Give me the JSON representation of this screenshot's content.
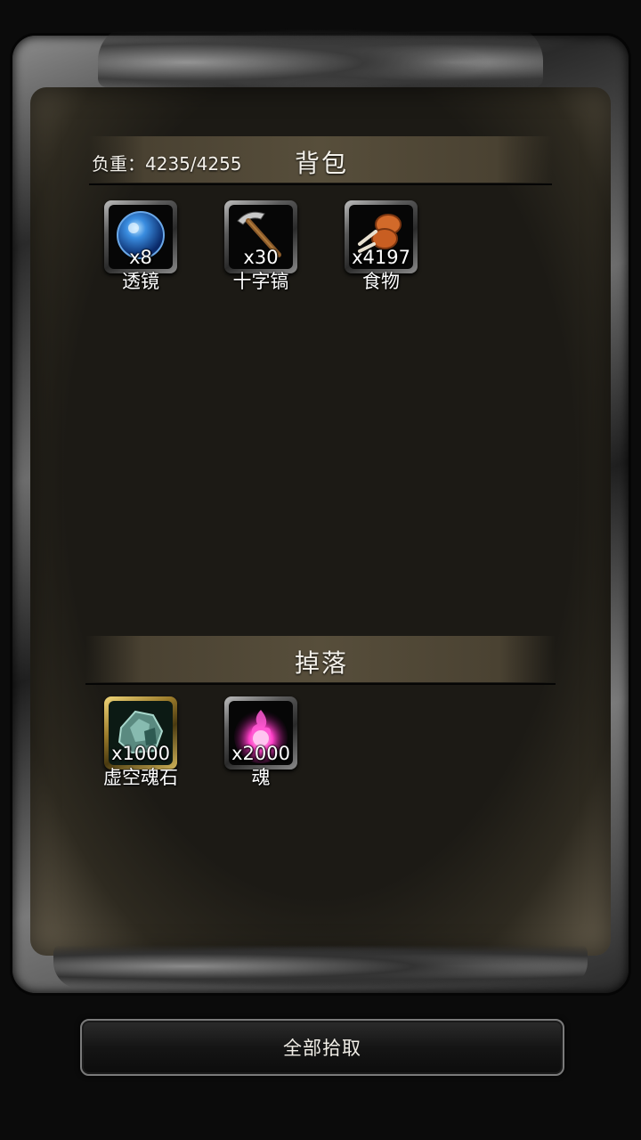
{
  "backpack": {
    "weight_text": "负重：4235/4255",
    "title": "背包",
    "items": [
      {
        "name": "透镜",
        "count": "x8",
        "icon": "lens-icon"
      },
      {
        "name": "十字镐",
        "count": "x30",
        "icon": "pickaxe-icon"
      },
      {
        "name": "食物",
        "count": "x4197",
        "icon": "food-icon"
      }
    ]
  },
  "drops": {
    "title": "掉落",
    "items": [
      {
        "name": "虚空魂石",
        "count": "x1000",
        "icon": "void-soulstone-icon"
      },
      {
        "name": "魂",
        "count": "x2000",
        "icon": "soul-icon"
      }
    ]
  },
  "actions": {
    "pickup_all_label": "全部拾取"
  },
  "colors": {
    "panel_bg": "#1c1a15",
    "header_band": "#574e3b",
    "text": "#f4f1ea",
    "gold_frame": "#d3b65a"
  }
}
